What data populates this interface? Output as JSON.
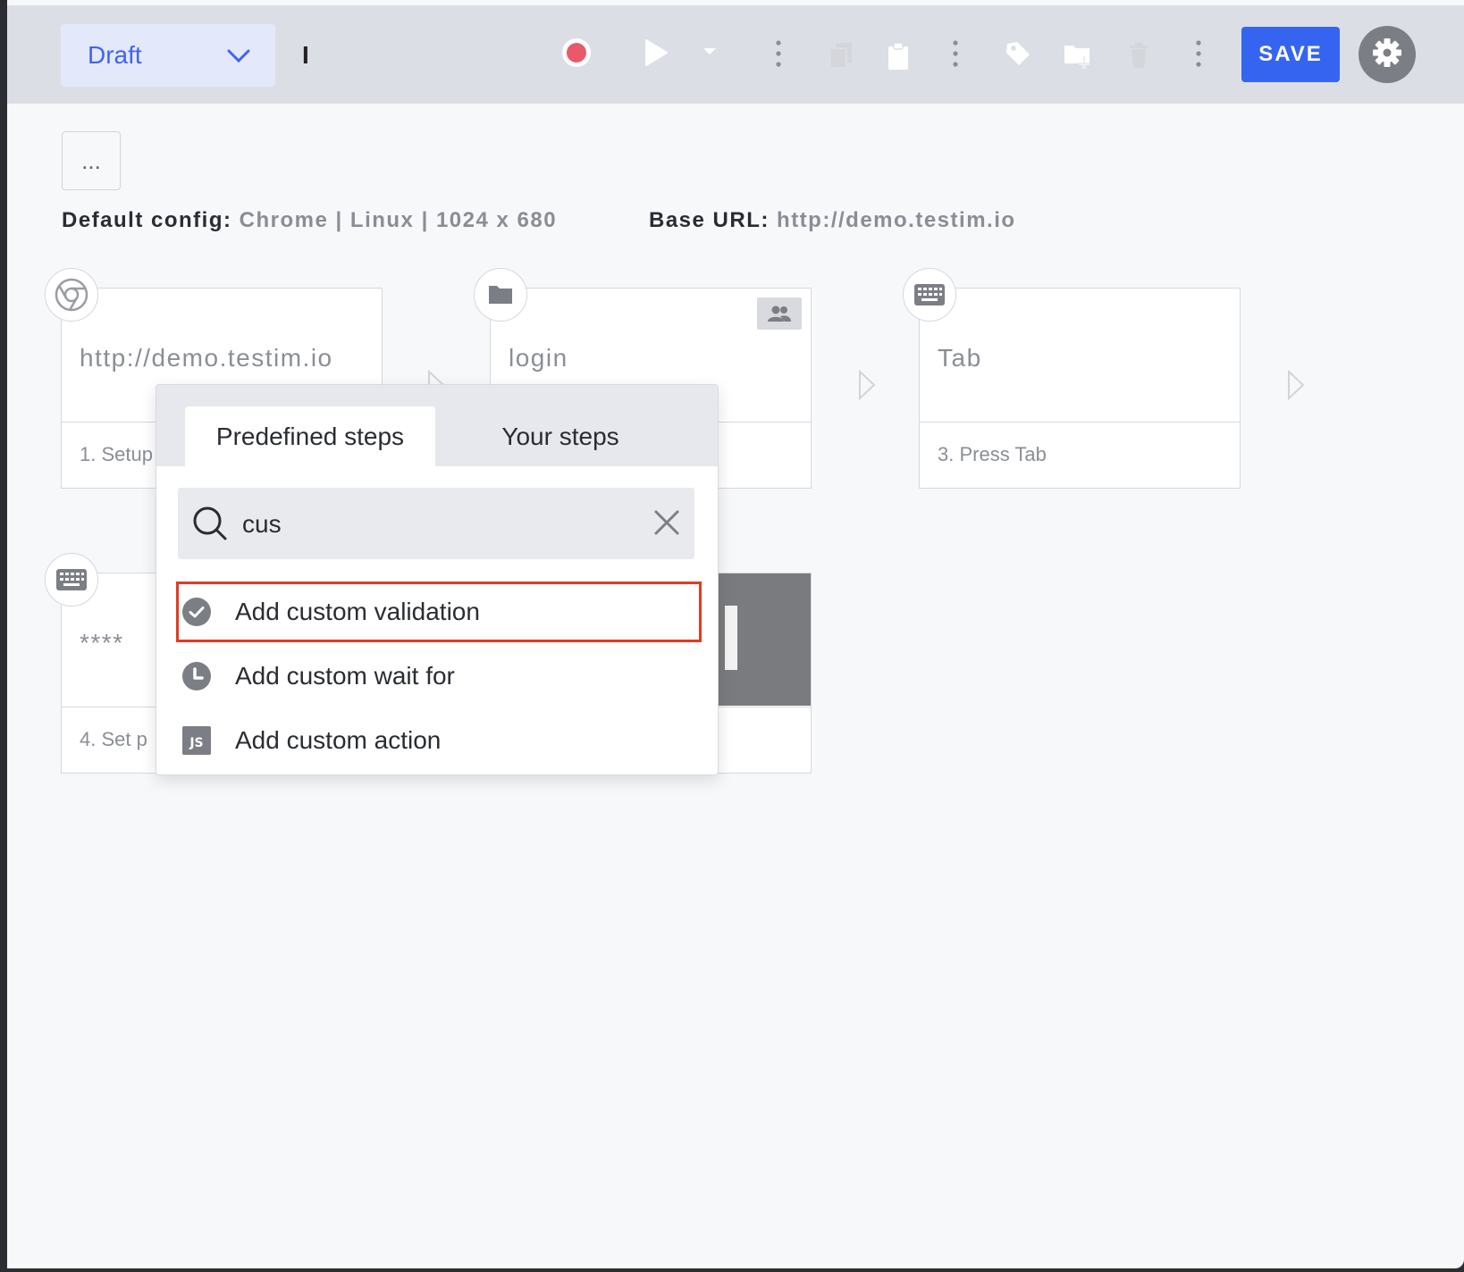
{
  "toolbar": {
    "status_value": "Draft",
    "test_name": "I",
    "save_label": "SAVE",
    "icons": [
      "record-icon",
      "play-icon",
      "play-dropdown-icon",
      "more-vert-icon",
      "copy-icon",
      "paste-icon",
      "more-vert-icon",
      "tag-icon",
      "add-folder-icon",
      "delete-icon",
      "more-vert-icon",
      "settings-icon"
    ],
    "record_color": "#e85a6a",
    "save_color": "#3564f0"
  },
  "config": {
    "more_label": "...",
    "default_label": "Default config:",
    "default_value": "Chrome | Linux | 1024 x 680",
    "base_label": "Base URL:",
    "base_value": "http://demo.testim.io"
  },
  "steps": [
    {
      "value": "http://demo.testim.io",
      "footer": "1. Setup",
      "icon": "chrome-icon"
    },
    {
      "value": "login",
      "footer": "",
      "icon": "folder-icon",
      "badge": "shared-group-icon"
    },
    {
      "value": "Tab",
      "footer": "3. Press Tab",
      "icon": "keyboard-icon"
    },
    {
      "value": "****",
      "footer": "4. Set p",
      "icon": "keyboard-icon"
    },
    {
      "value": "",
      "footer": "",
      "icon": "screenshot-thumbnail"
    }
  ],
  "popover": {
    "tabs": [
      {
        "label": "Predefined steps",
        "active": true
      },
      {
        "label": "Your steps",
        "active": false
      }
    ],
    "search_value": "cus",
    "results": [
      {
        "label": "Add custom validation",
        "icon": "check-circle-icon",
        "highlighted": true
      },
      {
        "label": "Add custom wait for",
        "icon": "clock-icon",
        "highlighted": false
      },
      {
        "label": "Add custom action",
        "icon": "js-icon",
        "highlighted": false
      }
    ],
    "highlight_color": "#e23b22"
  }
}
